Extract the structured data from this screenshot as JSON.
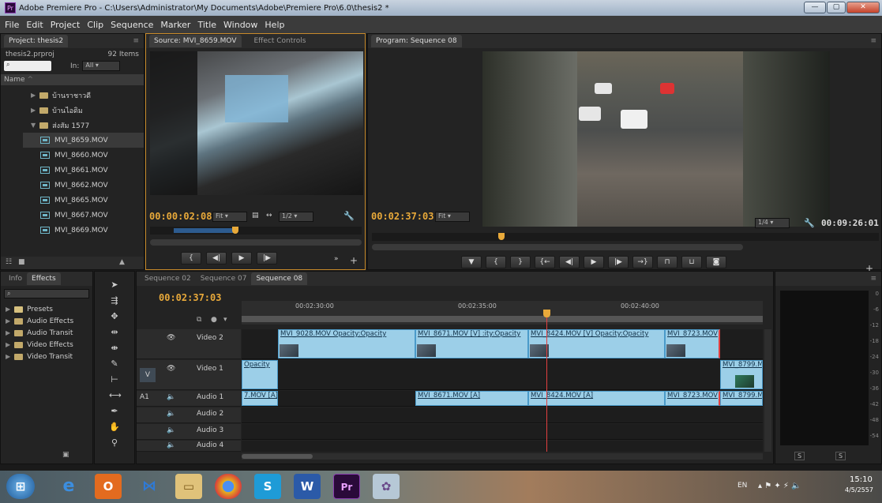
{
  "window": {
    "app_icon": "Pr",
    "title": "Adobe Premiere Pro - C:\\Users\\Administrator\\My Documents\\Adobe\\Premiere Pro\\6.0\\thesis2 *",
    "controls": [
      "minimize",
      "maximize",
      "close"
    ]
  },
  "menu": [
    "File",
    "Edit",
    "Project",
    "Clip",
    "Sequence",
    "Marker",
    "Title",
    "Window",
    "Help"
  ],
  "project": {
    "tab": "Project: thesis2",
    "file": "thesis2.prproj",
    "count": "92 Items",
    "in_label": "In:",
    "in_value": "All",
    "column_header": "Name",
    "folders": [
      "บ้านราชาวดี",
      "บ้านไอดิม",
      "ส่งสัม 1577"
    ],
    "clips": [
      "MVI_8659.MOV",
      "MVI_8660.MOV",
      "MVI_8661.MOV",
      "MVI_8662.MOV",
      "MVI_8665.MOV",
      "MVI_8667.MOV",
      "MVI_8669.MOV"
    ]
  },
  "source": {
    "tab": "Source: MVI_8659.MOV",
    "tab2": "Effect Controls",
    "timecode": "00:00:02:08",
    "fit": "Fit",
    "resolution": "1/2"
  },
  "program": {
    "tab": "Program: Sequence 08",
    "timecode": "00:02:37:03",
    "fit": "Fit",
    "resolution": "1/4",
    "duration": "00:09:26:01"
  },
  "effects": {
    "tab_info": "Info",
    "tab": "Effects",
    "folders": [
      "Presets",
      "Audio Effects",
      "Audio Transit",
      "Video Effects",
      "Video Transit"
    ]
  },
  "timeline": {
    "tabs": [
      "Sequence 02",
      "Sequence 07",
      "Sequence 08"
    ],
    "timecode": "00:02:37:03",
    "ruler": [
      "00:02:30:00",
      "00:02:35:00",
      "00:02:40:00"
    ],
    "tracks": {
      "v2": "Video 2",
      "v1": "Video 1",
      "a1": "Audio 1",
      "a2": "Audio 2",
      "a3": "Audio 3",
      "a4": "Audio 4",
      "v_target": "V",
      "a_target": "A1"
    },
    "v2_clips": [
      "MVI_9028.MOV Opacity:Opacity",
      "MVI_8671.MOV [V] :ity:Opacity",
      "MVI_8424.MOV [V] Opacity:Opacity",
      "MVI_8723.MOV"
    ],
    "v1_clips": [
      "Opacity",
      "MVI_8799.M"
    ],
    "a1_clips": [
      "7.MOV [A]",
      "MVI_8671.MOV [A]",
      "MVI_8424.MOV [A]",
      "MVI_8723.MOV",
      "MVI_8799.M"
    ]
  },
  "meter": {
    "labels": [
      "0",
      "-6",
      "-12",
      "-18",
      "-24",
      "-30",
      "-36",
      "-42",
      "-48",
      "-54"
    ],
    "solo": [
      "S",
      "S"
    ]
  },
  "taskbar": {
    "lang": "EN",
    "time": "15:10",
    "date": "4/5/2557"
  },
  "colors": {
    "timecode": "#e8a93a",
    "clip": "#9ccfe8",
    "playhead": "#e34040"
  }
}
